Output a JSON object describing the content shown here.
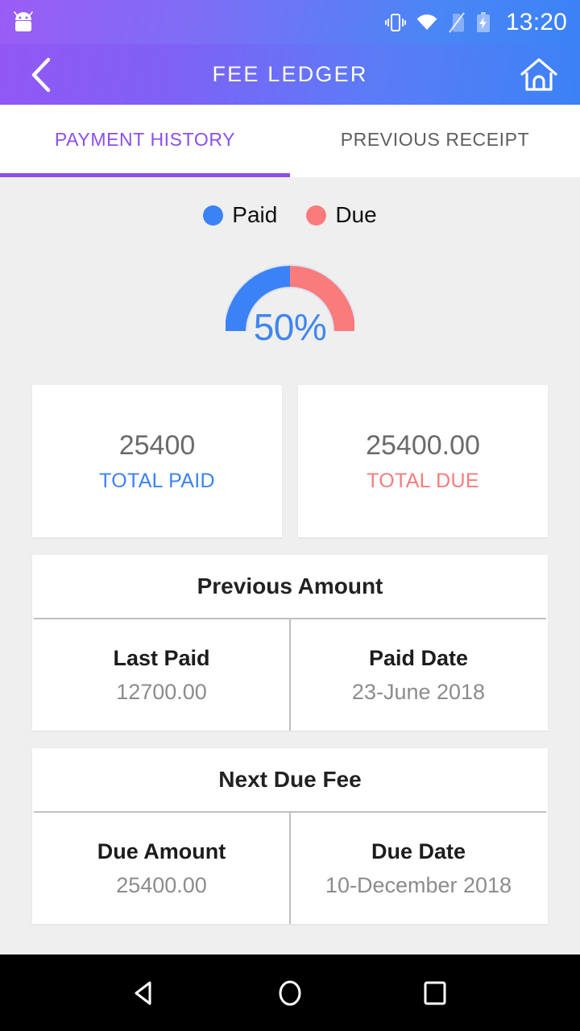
{
  "status_bar": {
    "time": "13:20",
    "icons": [
      "android-robot-icon",
      "vibrate-icon",
      "wifi-icon",
      "no-sim-icon",
      "battery-charging-icon"
    ]
  },
  "app_bar": {
    "title": "FEE LEDGER",
    "back_icon": "chevron-left-icon",
    "home_icon": "home-icon"
  },
  "tabs": [
    {
      "label": "PAYMENT HISTORY",
      "active": true
    },
    {
      "label": "PREVIOUS RECEIPT",
      "active": false
    }
  ],
  "legend": [
    {
      "label": "Paid",
      "color": "#3b82f6"
    },
    {
      "label": "Due",
      "color": "#fa7b7b"
    }
  ],
  "chart_data": {
    "type": "pie",
    "title": "",
    "shape": "semicircle-donut-gauge",
    "center_label": "50%",
    "center_label_color": "#3f86ef",
    "categories": [
      "Paid",
      "Due"
    ],
    "values": [
      50,
      50
    ],
    "unit": "percent",
    "colors": [
      "#3b82f6",
      "#fa7b7b"
    ],
    "legend_position": "top",
    "grid": false,
    "start_angle": 180,
    "end_angle": 0
  },
  "totals": [
    {
      "value": "25400",
      "label": "TOTAL PAID",
      "color": "#3b82f6"
    },
    {
      "value": "25400.00",
      "label": "TOTAL DUE",
      "color": "#fa7b7b"
    }
  ],
  "sections": [
    {
      "title": "Previous Amount",
      "columns": [
        {
          "label": "Last Paid",
          "value": "12700.00"
        },
        {
          "label": "Paid Date",
          "value": "23-June 2018"
        }
      ]
    },
    {
      "title": "Next Due Fee",
      "columns": [
        {
          "label": "Due Amount",
          "value": "25400.00"
        },
        {
          "label": "Due Date",
          "value": "10-December 2018"
        }
      ]
    }
  ],
  "nav_bar": {
    "back": "triangle-back-icon",
    "home": "circle-home-icon",
    "recents": "square-recents-icon"
  }
}
